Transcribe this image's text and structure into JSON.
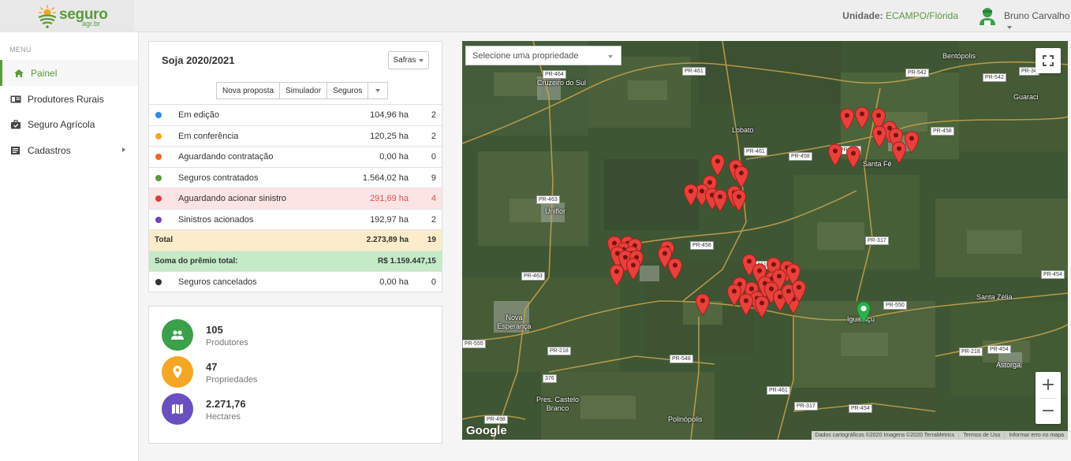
{
  "brand": {
    "name": "seguro",
    "domain": "agr.br",
    "accent": "#5b9a3d"
  },
  "header": {
    "unit_label": "Unidade:",
    "unit_value": "ECAMPO/Flórida",
    "user_name": "Bruno Carvalho"
  },
  "sidebar": {
    "menu_label": "MENU",
    "items": [
      {
        "label": "Painel",
        "icon": "home-icon",
        "active": true
      },
      {
        "label": "Produtores Rurais",
        "icon": "id-card-icon"
      },
      {
        "label": "Seguro Agrícola",
        "icon": "briefcase-icon"
      },
      {
        "label": "Cadastros",
        "icon": "list-icon",
        "has_submenu": true
      }
    ]
  },
  "summary": {
    "title": "Soja 2020/2021",
    "safras_label": "Safras",
    "actions": [
      "Nova proposta",
      "Simulador",
      "Seguros"
    ],
    "rows": [
      {
        "label": "Em edição",
        "area": "104,96 ha",
        "count": "2",
        "color": "#2e8ae6"
      },
      {
        "label": "Em conferência",
        "area": "120,25 ha",
        "count": "2",
        "color": "#f5a623"
      },
      {
        "label": "Aguardando contratação",
        "area": "0,00 ha",
        "count": "0",
        "color": "#f26522"
      },
      {
        "label": "Seguros contratados",
        "area": "1.564,02 ha",
        "count": "9",
        "color": "#5b9a3d"
      },
      {
        "label": "Aguardando acionar sinistro",
        "area": "291,69 ha",
        "count": "4",
        "color": "#e53935"
      },
      {
        "label": "Sinistros acionados",
        "area": "192,97 ha",
        "count": "2",
        "color": "#6f42c1"
      }
    ],
    "total": {
      "label": "Total",
      "area": "2.273,89 ha",
      "count": "19"
    },
    "premio": {
      "label": "Soma do prêmio total:",
      "value": "R$ 1.159.447,15"
    },
    "cancelled": {
      "label": "Seguros cancelados",
      "area": "0,00 ha",
      "count": "0",
      "color": "#333333"
    }
  },
  "stats": [
    {
      "value": "105",
      "label": "Produtores",
      "icon": "people-icon",
      "color": "#3aa04a"
    },
    {
      "value": "47",
      "label": "Propriedades",
      "icon": "map-pin-icon",
      "color": "#f5a623"
    },
    {
      "value": "2.271,76",
      "label": "Hectares",
      "icon": "map-icon",
      "color": "#6a4fc1"
    }
  ],
  "map": {
    "select_placeholder": "Selecione uma propriedade",
    "places": [
      "Cruzeiro do Sul",
      "Lobato",
      "Bentópolis",
      "Guaraci",
      "Santa Fé",
      "Uniflor",
      "Nova Esperança",
      "Santa Zélia",
      "Iguaraçu",
      "Astorga",
      "Pres. Castelo Branco",
      "Polinópolis"
    ],
    "roads": [
      "PR-464",
      "PR-461",
      "PR-542",
      "PR-542",
      "PR-34",
      "PR-458",
      "PR-458",
      "PR-461",
      "PR-458",
      "PR-463",
      "PR-458",
      "PR-317",
      "PR-461",
      "PR-463",
      "PR-454",
      "PR-550",
      "PR-555",
      "PR-218",
      "PR-548",
      "PR-218",
      "PR-454",
      "376",
      "PR-461",
      "PR-317",
      "PR-454",
      "PR-498"
    ],
    "attribution": [
      "Dados cartográficos ©2020 Imagens ©2020 TerraMetrics",
      "Termos de Uso",
      "Informar erro no mapa"
    ],
    "google_label": "Google",
    "zoom_in": "+",
    "zoom_out": "−"
  }
}
